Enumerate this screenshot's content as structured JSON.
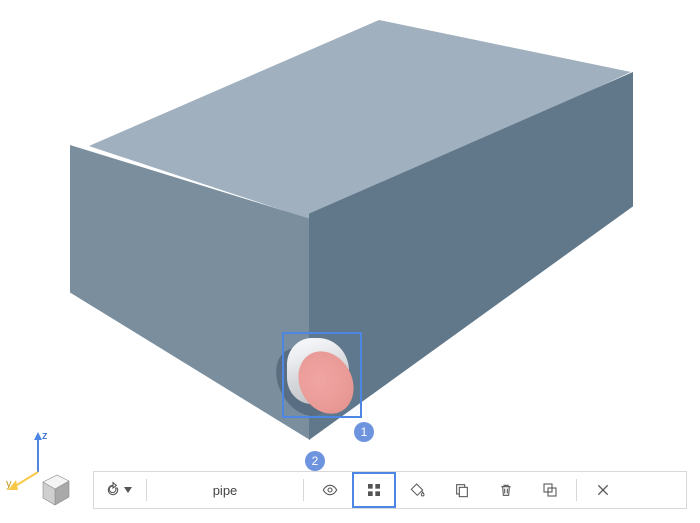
{
  "viewport": {
    "box_top_color": "#A0B0BE",
    "box_left_color": "#7A8E9E",
    "box_right_color": "#61788B",
    "pipe_face_color": "#EE9992"
  },
  "axes": {
    "z_label": "z",
    "y_label": "y",
    "z_color": "#4E86E4",
    "y_color": "#F7C948",
    "x_color": "#4E86E4"
  },
  "callouts": {
    "one": "1",
    "two": "2"
  },
  "toolbar": {
    "refresh_icon": "refresh",
    "object_name": "pipe",
    "visibility_icon": "eye",
    "category_icon": "grid",
    "paint_icon": "paint-bucket",
    "copy_icon": "copy",
    "delete_icon": "trash",
    "overlap_icon": "overlap",
    "close_icon": "close"
  }
}
